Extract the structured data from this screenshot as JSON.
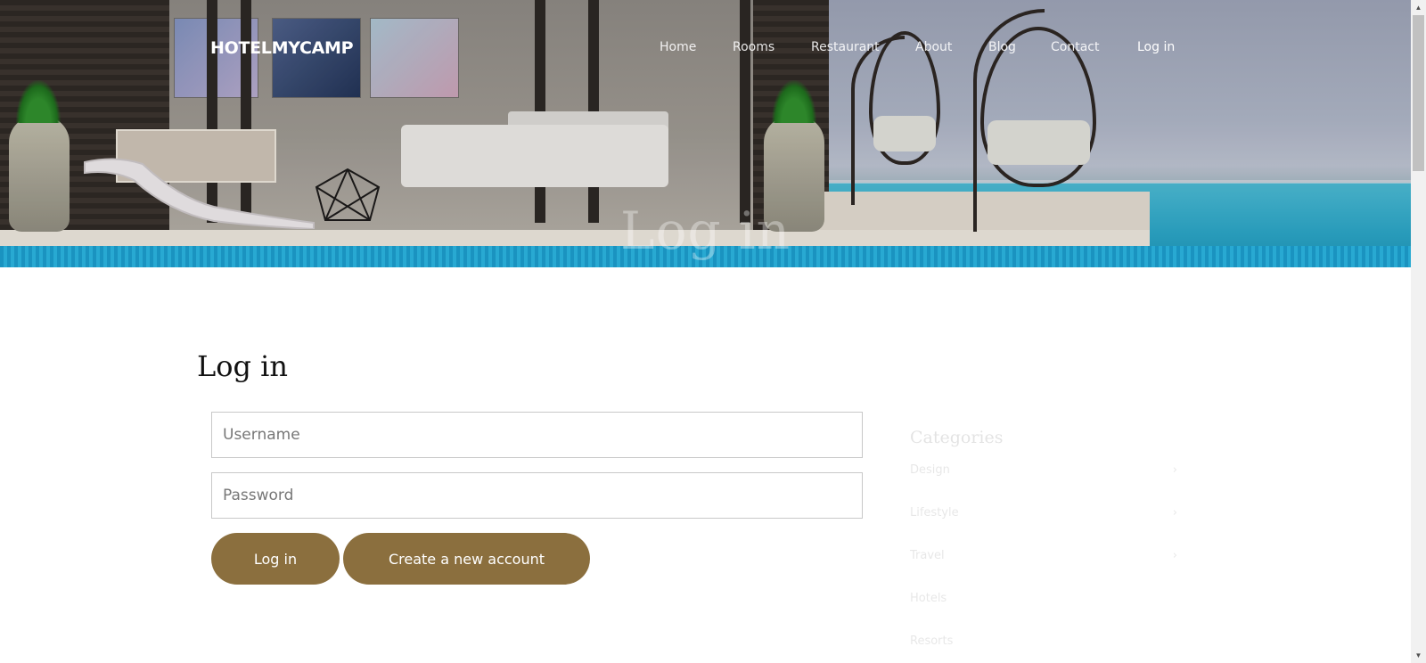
{
  "brand": {
    "logo": "HOTELMYCAMP"
  },
  "nav": {
    "items": [
      {
        "label": "Home"
      },
      {
        "label": "Rooms"
      },
      {
        "label": "Restaurant"
      },
      {
        "label": "About"
      },
      {
        "label": "Blog"
      },
      {
        "label": "Contact"
      },
      {
        "label": "Log in"
      }
    ]
  },
  "hero": {
    "title": "Log in"
  },
  "login": {
    "heading": "Log in",
    "username_placeholder": "Username",
    "password_placeholder": "Password",
    "login_button": "Log in",
    "create_account_button": "Create a new account"
  },
  "sidebar": {
    "title": "Categories",
    "items": [
      {
        "label": "Design",
        "arrow": "›"
      },
      {
        "label": "Lifestyle",
        "arrow": "›"
      },
      {
        "label": "Travel",
        "arrow": "›"
      },
      {
        "label": "Hotels",
        "arrow": ""
      },
      {
        "label": "Resorts",
        "arrow": ""
      }
    ]
  },
  "colors": {
    "accent": "#8b6f3e",
    "text": "#111111"
  }
}
